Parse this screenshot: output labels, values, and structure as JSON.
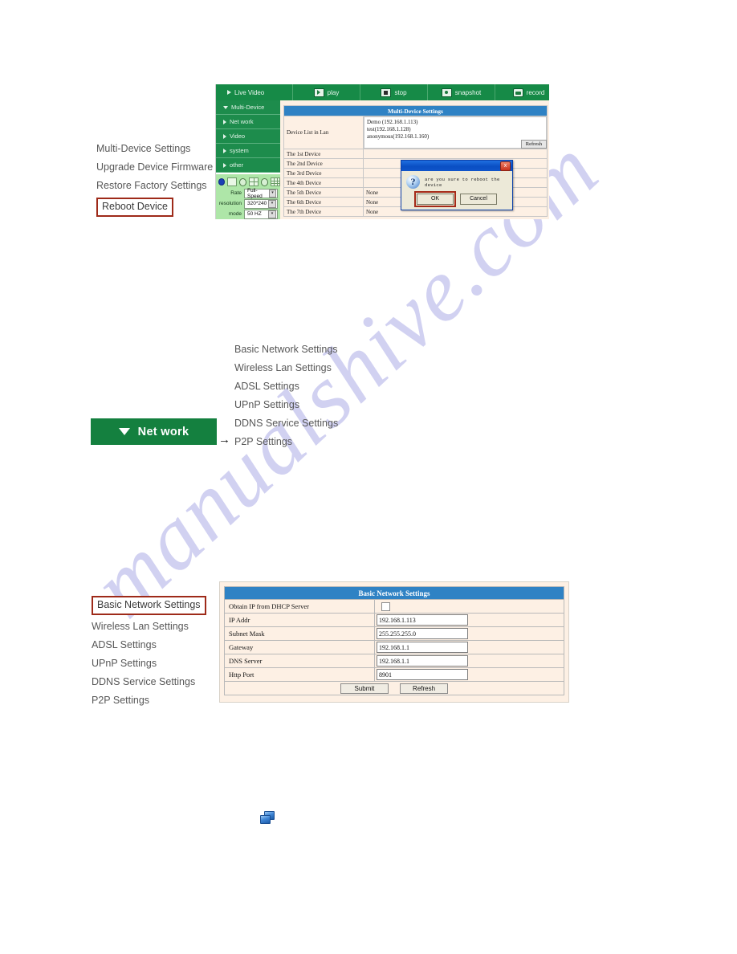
{
  "document": {
    "watermark": "manualshive.com"
  },
  "section_system": {
    "menu_items": [
      "Multi-Device Settings",
      "Upgrade Device Firmware",
      "Restore Factory Settings",
      "Reboot Device"
    ],
    "highlighted_item": "Reboot Device"
  },
  "camera_ui": {
    "toolbar": [
      {
        "label": "Live Video",
        "icon": "play-triangle-icon"
      },
      {
        "label": "play",
        "icon": "play-icon"
      },
      {
        "label": "stop",
        "icon": "stop-icon"
      },
      {
        "label": "snapshot",
        "icon": "camera-icon"
      },
      {
        "label": "record",
        "icon": "record-icon"
      }
    ],
    "sidebar": [
      {
        "label": "Multi-Device",
        "state": "expanded"
      },
      {
        "label": "Net work",
        "state": "collapsed"
      },
      {
        "label": "Video",
        "state": "collapsed"
      },
      {
        "label": "system",
        "state": "collapsed"
      },
      {
        "label": "other",
        "state": "collapsed"
      }
    ],
    "controls": {
      "rate_label": "Rate",
      "rate_value": "Full-Speed",
      "resolution_label": "resolution",
      "resolution_value": "320*240",
      "mode_label": "mode",
      "mode_value": "50 HZ"
    },
    "panel": {
      "title": "Multi-Device Settings",
      "device_list_label": "Device List in Lan",
      "device_list": [
        "Demo (192.168.1.113)",
        "test(192.168.1.128)",
        "anonymous(192.168.1.160)"
      ],
      "refresh_label": "Refresh",
      "rows": [
        {
          "label": "The 1st Device",
          "value": "",
          "link": false
        },
        {
          "label": "The 2nd Device",
          "value": "",
          "link": true
        },
        {
          "label": "The 3rd Device",
          "value": "",
          "link": true
        },
        {
          "label": "The 4th Device",
          "value": "",
          "link": true
        },
        {
          "label": "The 5th Device",
          "value": "None",
          "link": true
        },
        {
          "label": "The 6th Device",
          "value": "None",
          "link": true
        },
        {
          "label": "The 7th Device",
          "value": "None",
          "link": true
        }
      ]
    },
    "dialog": {
      "message": "are you sure to reboot the device",
      "ok_label": "OK",
      "cancel_label": "Cancel",
      "close_label": "x",
      "question_glyph": "?"
    }
  },
  "section_network": {
    "button_label": "Net work",
    "caret": "down-caret-icon",
    "arrow": "→",
    "menu_items": [
      "Basic Network Settings",
      "Wireless Lan Settings",
      "ADSL Settings",
      "UPnP Settings",
      "DDNS Service Settings",
      "P2P Settings"
    ],
    "pointed_item": "P2P Settings"
  },
  "section_basic": {
    "menu_items": [
      "Basic Network Settings",
      "Wireless Lan Settings",
      "ADSL Settings",
      "UPnP Settings",
      "DDNS Service Settings",
      "P2P Settings"
    ],
    "highlighted_item": "Basic Network Settings",
    "panel": {
      "title": "Basic Network Settings",
      "rows": [
        {
          "label": "Obtain IP from DHCP Server",
          "type": "checkbox",
          "value": "",
          "checked": false
        },
        {
          "label": "IP Addr",
          "type": "text",
          "value": "192.168.1.113"
        },
        {
          "label": "Subnet Mask",
          "type": "text",
          "value": "255.255.255.0"
        },
        {
          "label": "Gateway",
          "type": "text",
          "value": "192.168.1.1"
        },
        {
          "label": "DNS Server",
          "type": "text",
          "value": "192.168.1.1"
        },
        {
          "label": "Http Port",
          "type": "text",
          "value": "8901"
        }
      ],
      "submit_label": "Submit",
      "refresh_label": "Refresh"
    }
  },
  "misc": {
    "network_icon_name": "network-places-icon"
  },
  "colors": {
    "toolbar_green": "#168a47",
    "sidebar_green": "#1d8c4c",
    "button_green": "#14803f",
    "panel_header_blue": "#2f82c4",
    "panel_bg": "#fdf0e4",
    "highlight_red": "#9e2a19",
    "dialog_title_blue": "#0a4fc4",
    "link_blue": "#2b3fa8",
    "watermark_purple": "#c9c9ef"
  }
}
